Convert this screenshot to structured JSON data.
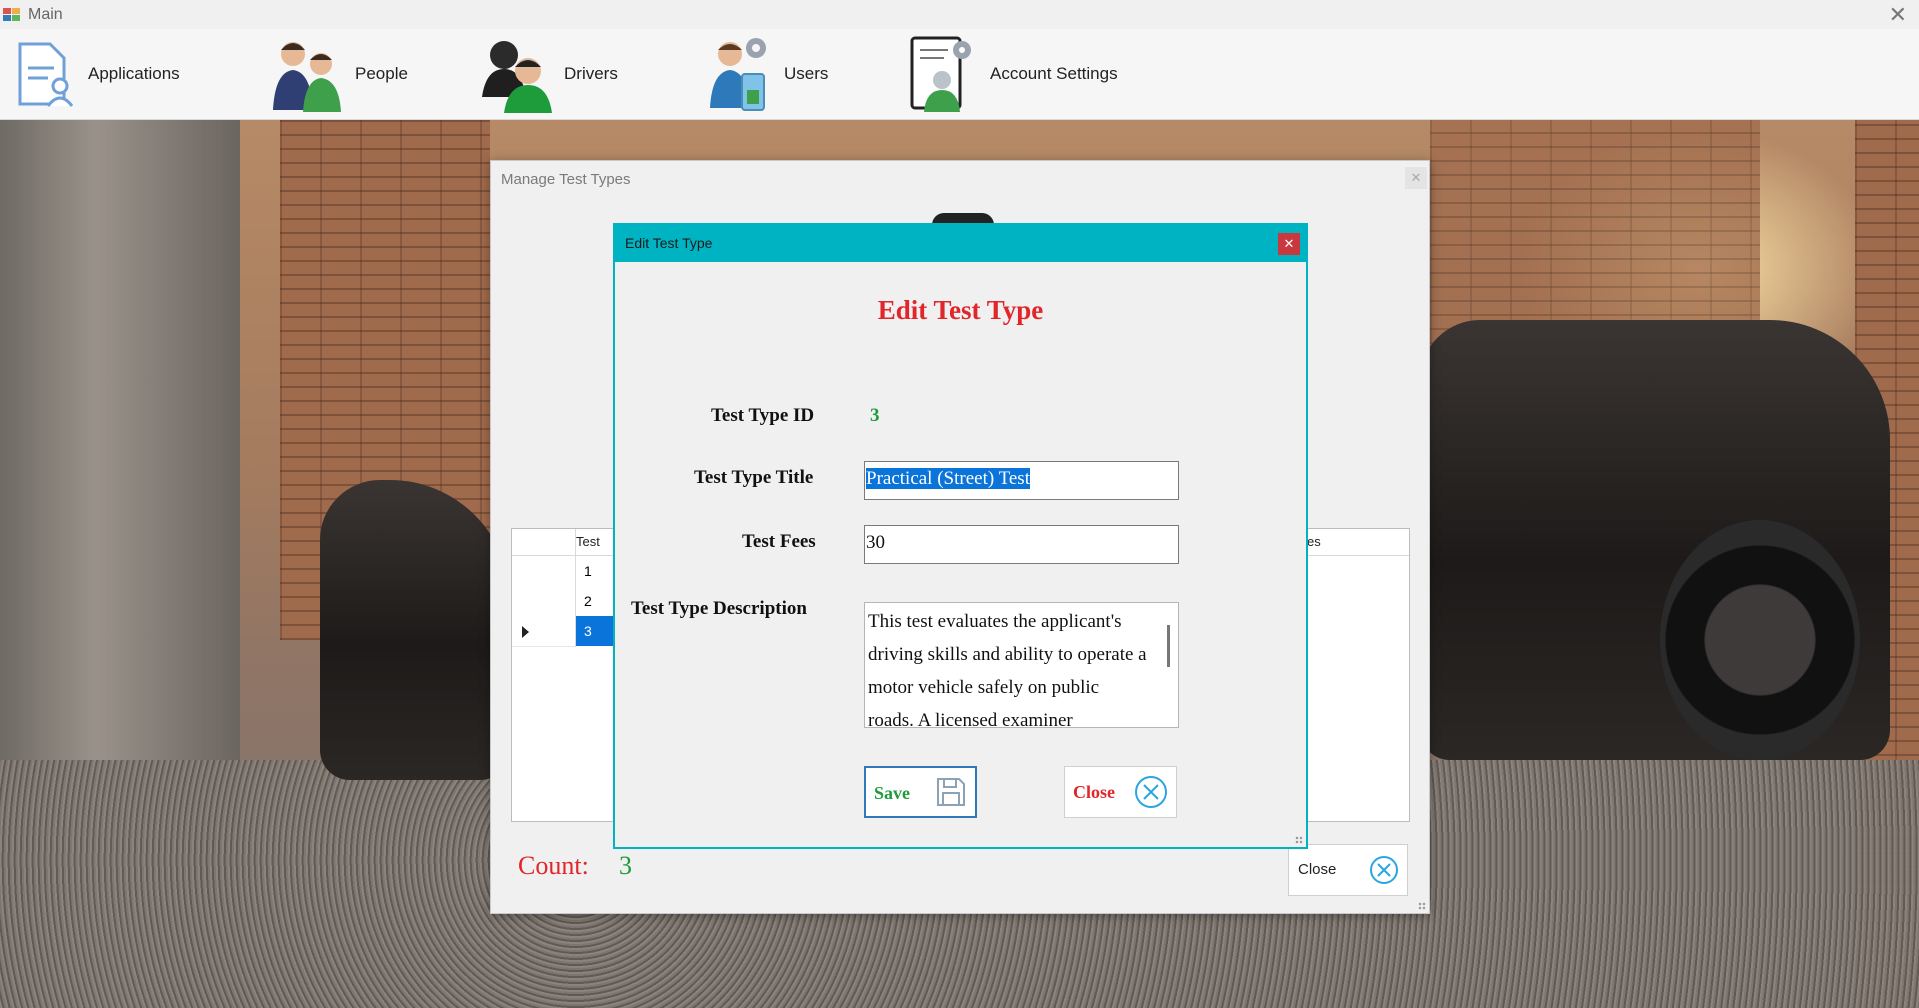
{
  "window": {
    "title": "Main"
  },
  "menu": {
    "items": [
      {
        "label": "Applications",
        "icon": "document-user-icon"
      },
      {
        "label": "People",
        "icon": "people-icon"
      },
      {
        "label": "Drivers",
        "icon": "drivers-icon"
      },
      {
        "label": "Users",
        "icon": "users-icon"
      },
      {
        "label": "Account Settings",
        "icon": "account-settings-icon"
      }
    ]
  },
  "manage_window": {
    "title": "Manage Test Types",
    "grid": {
      "header_first": "Test",
      "header_last": "es",
      "rows": [
        {
          "id": "1"
        },
        {
          "id": "2"
        },
        {
          "id": "3",
          "selected": true
        }
      ]
    },
    "count_label": "Count:",
    "count_value": "3",
    "close_label": "Close"
  },
  "edit_dialog": {
    "title": "Edit Test Type",
    "heading": "Edit Test Type",
    "id_label": "Test Type ID",
    "id_value": "3",
    "title_label": "Test Type Title",
    "title_value": "Practical (Street) Test",
    "fees_label": "Test Fees",
    "fees_value": "30",
    "description_label": "Test Type Description",
    "description_value": "This test evaluates the applicant's driving skills and ability to operate a motor vehicle safely on public roads. A licensed examiner",
    "save_label": "Save",
    "close_label": "Close"
  },
  "colors": {
    "accent_teal": "#00b3c3",
    "heading_red": "#e0262a",
    "value_green": "#1e9b3a",
    "selection_blue": "#0a74da"
  }
}
